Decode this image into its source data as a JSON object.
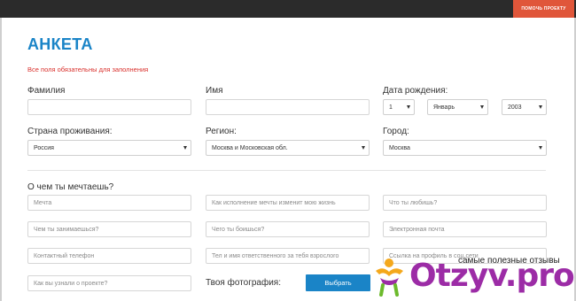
{
  "header": {
    "help_button": "помочь проекту"
  },
  "form": {
    "title": "АНКЕТА",
    "notice": "Все поля обязательны для заполнения",
    "labels": {
      "surname": "Фамилия",
      "name": "Имя",
      "birth_date": "Дата рождения:",
      "country": "Страна проживания:",
      "region": "Регион:",
      "city": "Город:",
      "dream": "О чем ты мечтаешь?",
      "photo": "Твоя фотография:"
    },
    "birth": {
      "day": "1",
      "month": "Январь",
      "year": "2003"
    },
    "country_value": "Россия",
    "region_value": "Москва и Московская обл.",
    "city_value": "Москва",
    "placeholders": {
      "dream": "Мечта",
      "dream_change": "Как исполнение мечты изменит мою жизнь",
      "love": "Что ты любишь?",
      "occupation": "Чем ты занимаешься?",
      "fear": "Чего ты боишься?",
      "email": "Электронная почта",
      "phone": "Контактный телефон",
      "guardian": "Тел и имя ответственного за тебя взрослого",
      "social": "Ссылка на профиль в соц.сети",
      "source": "Как вы узнали о проекте?"
    },
    "choose_button": "Выбрать"
  },
  "watermark": {
    "tagline": "самые полезные отзывы",
    "logo": "Otzyv.pro",
    "brand_color": "#9c2ca6"
  }
}
